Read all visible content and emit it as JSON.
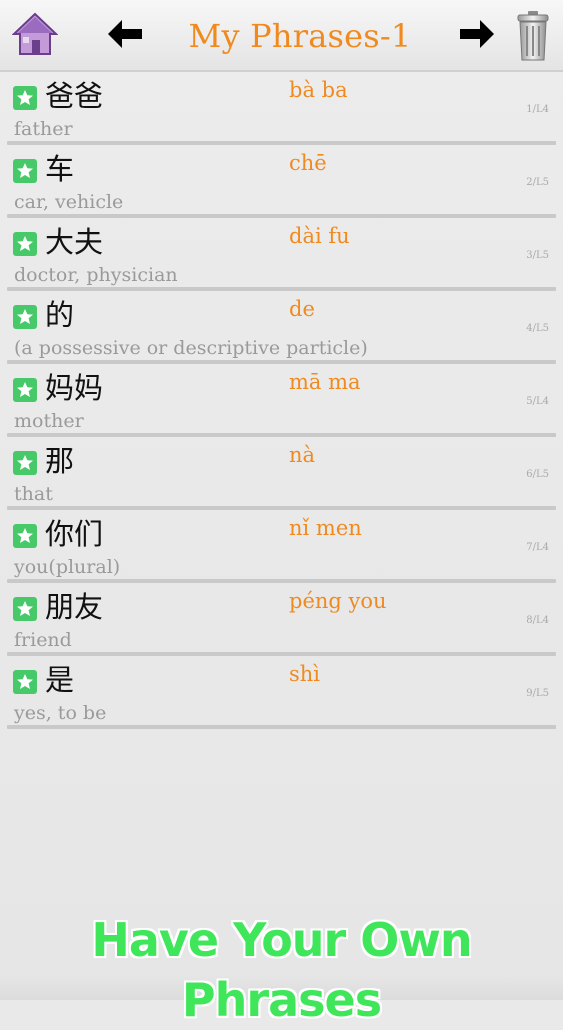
{
  "header": {
    "title": "My Phrases-1",
    "home_icon": "home-icon",
    "prev_icon": "arrow-left-icon",
    "next_icon": "arrow-right-icon",
    "trash_icon": "trash-icon"
  },
  "colors": {
    "accent": "#f08a1f",
    "star_green": "#47c96a",
    "promo_green": "#3fe65a"
  },
  "phrases": [
    {
      "hanzi": "爸爸",
      "pinyin": "bà ba",
      "meaning": "father",
      "counter": "1/L4"
    },
    {
      "hanzi": "车",
      "pinyin": "chē",
      "meaning": "car, vehicle",
      "counter": "2/L5"
    },
    {
      "hanzi": "大夫",
      "pinyin": "dài fu",
      "meaning": "doctor, physician",
      "counter": "3/L5"
    },
    {
      "hanzi": "的",
      "pinyin": "de",
      "meaning": "(a possessive or descriptive particle)",
      "counter": "4/L5"
    },
    {
      "hanzi": "妈妈",
      "pinyin": "mā ma",
      "meaning": "mother",
      "counter": "5/L4"
    },
    {
      "hanzi": "那",
      "pinyin": "nà",
      "meaning": "that",
      "counter": "6/L5"
    },
    {
      "hanzi": "你们",
      "pinyin": "nǐ men",
      "meaning": "you(plural)",
      "counter": "7/L4"
    },
    {
      "hanzi": "朋友",
      "pinyin": "péng you",
      "meaning": "friend",
      "counter": "8/L4"
    },
    {
      "hanzi": "是",
      "pinyin": "shì",
      "meaning": "yes, to be",
      "counter": "9/L5"
    }
  ],
  "promo": {
    "text": "Have Your Own Phrases"
  }
}
